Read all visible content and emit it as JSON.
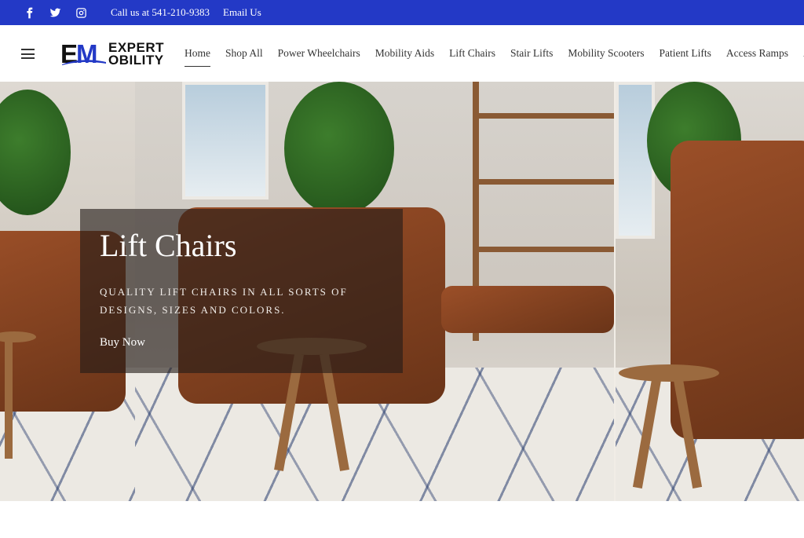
{
  "topbar": {
    "phone": "Call us at 541-210-9383",
    "email": "Email Us",
    "background": "#2339c6",
    "social": [
      "facebook-icon",
      "twitter-icon",
      "instagram-icon"
    ]
  },
  "logo": {
    "mark_left": "E",
    "mark_right": "M",
    "line1": "EXPERT",
    "line2": "OBILITY"
  },
  "nav": {
    "items": [
      "Home",
      "Shop All",
      "Power Wheelchairs",
      "Mobility Aids",
      "Lift Chairs",
      "Stair Lifts",
      "Mobility Scooters",
      "Patient Lifts",
      "Access Ramps",
      "A"
    ],
    "active": "Home"
  },
  "hero": {
    "title": "Lift Chairs",
    "subtitle": "Quality lift chairs in all sorts of designs, sizes and colors.",
    "cta": "Buy Now"
  }
}
